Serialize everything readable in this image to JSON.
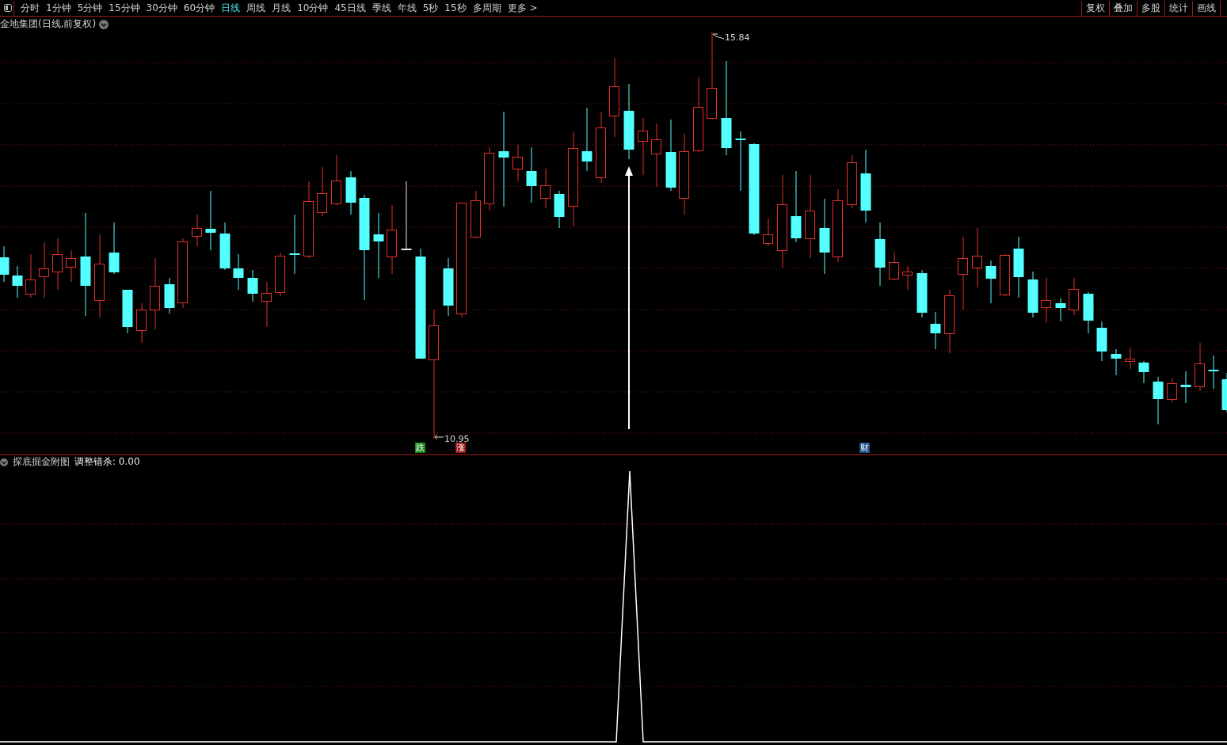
{
  "toolbar": {
    "periods": [
      {
        "label": "分时",
        "selected": false
      },
      {
        "label": "1分钟",
        "selected": false
      },
      {
        "label": "5分钟",
        "selected": false
      },
      {
        "label": "15分钟",
        "selected": false
      },
      {
        "label": "30分钟",
        "selected": false
      },
      {
        "label": "60分钟",
        "selected": false
      },
      {
        "label": "日线",
        "selected": true
      },
      {
        "label": "周线",
        "selected": false
      },
      {
        "label": "月线",
        "selected": false
      },
      {
        "label": "10分钟",
        "selected": false
      },
      {
        "label": "45日线",
        "selected": false
      },
      {
        "label": "季线",
        "selected": false
      },
      {
        "label": "年线",
        "selected": false
      },
      {
        "label": "5秒",
        "selected": false
      },
      {
        "label": "15秒",
        "selected": false
      },
      {
        "label": "多周期",
        "selected": false
      },
      {
        "label": "更多 >",
        "selected": false
      }
    ],
    "actions": [
      "复权",
      "叠加",
      "多股",
      "统计",
      "画线"
    ]
  },
  "main_chart": {
    "title": "金地集团(日线,前复权)",
    "high_label": "15.84",
    "low_label": "10.95",
    "signals": [
      {
        "label": "跌",
        "color": "#1a8a1a"
      },
      {
        "label": "涨",
        "color": "#9a1a1a"
      },
      {
        "label": "财",
        "color": "#1d4e8a"
      }
    ]
  },
  "sub_chart": {
    "title": "探底掘金附图",
    "indicator": "调整错杀: 0.00"
  }
}
